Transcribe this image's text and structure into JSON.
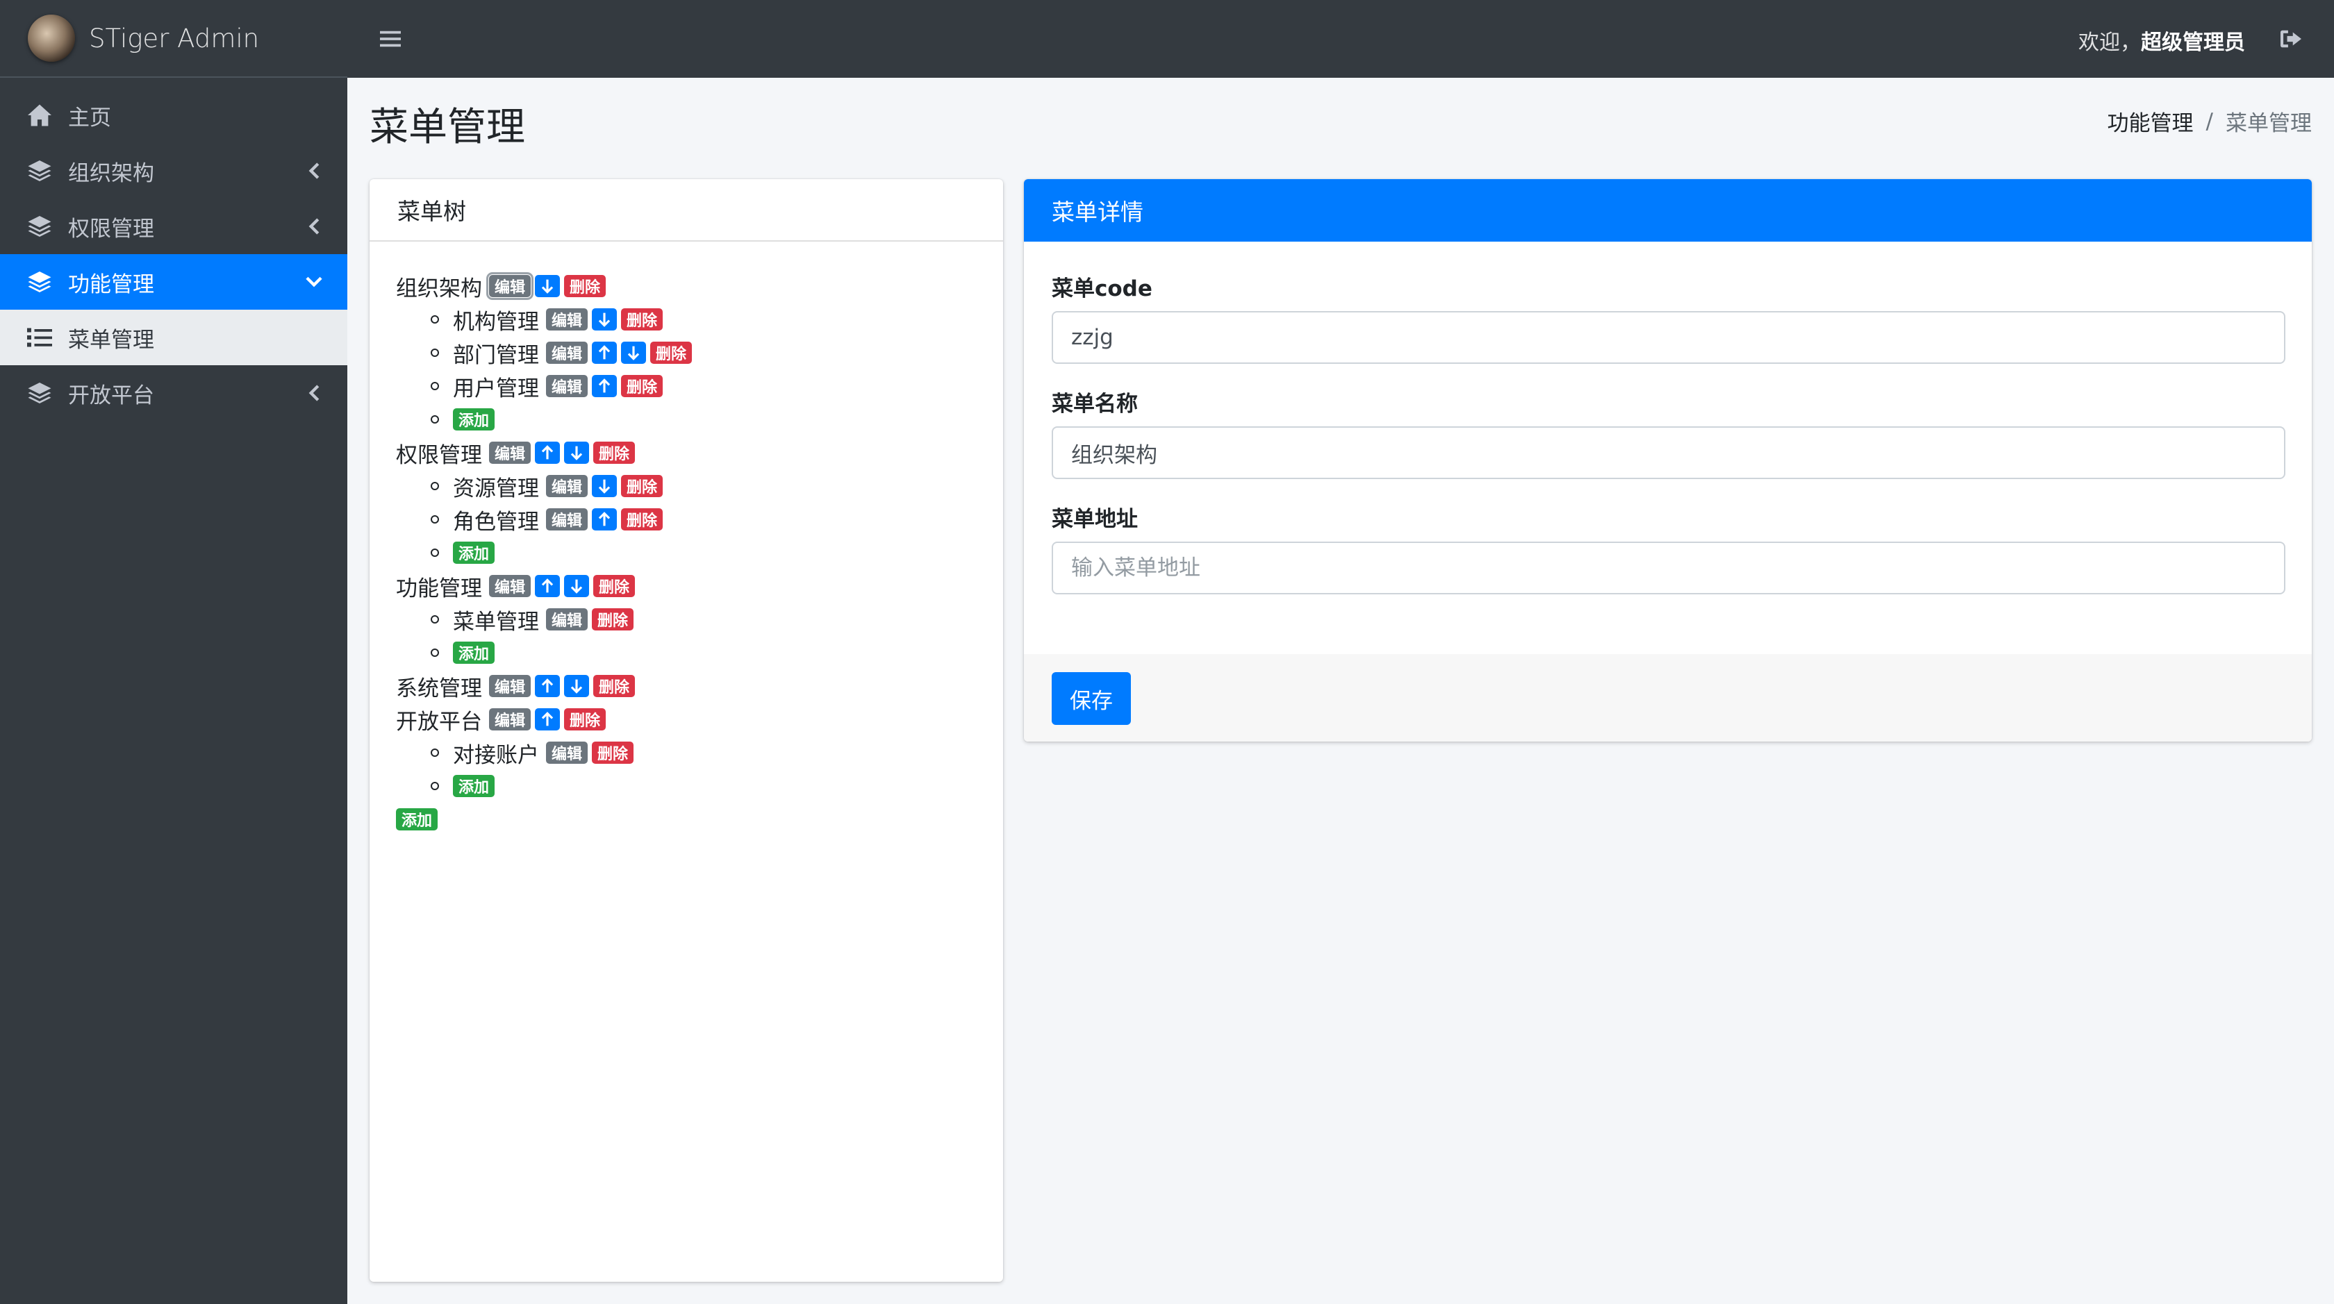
{
  "brand": {
    "title": "STiger Admin",
    "logo_icon": "avatar-logo"
  },
  "sidebar": {
    "items": [
      {
        "label": "主页",
        "icon": "home-icon"
      },
      {
        "label": "组织架构",
        "icon": "layers-icon"
      },
      {
        "label": "权限管理",
        "icon": "layers-icon"
      },
      {
        "label": "功能管理",
        "icon": "layers-icon",
        "active": true
      },
      {
        "label": "菜单管理",
        "icon": "list-icon",
        "sub": true
      },
      {
        "label": "开放平台",
        "icon": "layers-icon"
      }
    ]
  },
  "header": {
    "welcome_prefix": "欢迎，",
    "username": "超级管理员"
  },
  "page": {
    "title": "菜单管理",
    "breadcrumb": {
      "parent": "功能管理",
      "separator": "/",
      "current": "菜单管理"
    }
  },
  "tree_card": {
    "title": "菜单树",
    "edit_label": "编辑",
    "delete_label": "删除",
    "add_label": "添加",
    "nodes": [
      {
        "label": "组织架构",
        "children": [
          "机构管理",
          "部门管理",
          "用户管理"
        ]
      },
      {
        "label": "权限管理",
        "children": [
          "资源管理",
          "角色管理"
        ]
      },
      {
        "label": "功能管理",
        "children": [
          "菜单管理"
        ]
      },
      {
        "label": "系统管理",
        "children": []
      },
      {
        "label": "开放平台",
        "children": [
          "对接账户"
        ]
      }
    ]
  },
  "detail_card": {
    "title": "菜单详情",
    "code_label": "菜单code",
    "code_value": "zzjg",
    "name_label": "菜单名称",
    "name_value": "组织架构",
    "url_label": "菜单地址",
    "url_placeholder": "输入菜单地址",
    "save_label": "保存"
  },
  "colors": {
    "sidebar_bg": "#343a40",
    "primary": "#007bff",
    "secondary": "#6c757d",
    "danger": "#dc3545",
    "success": "#28a745",
    "content_bg": "#f4f6f9"
  }
}
